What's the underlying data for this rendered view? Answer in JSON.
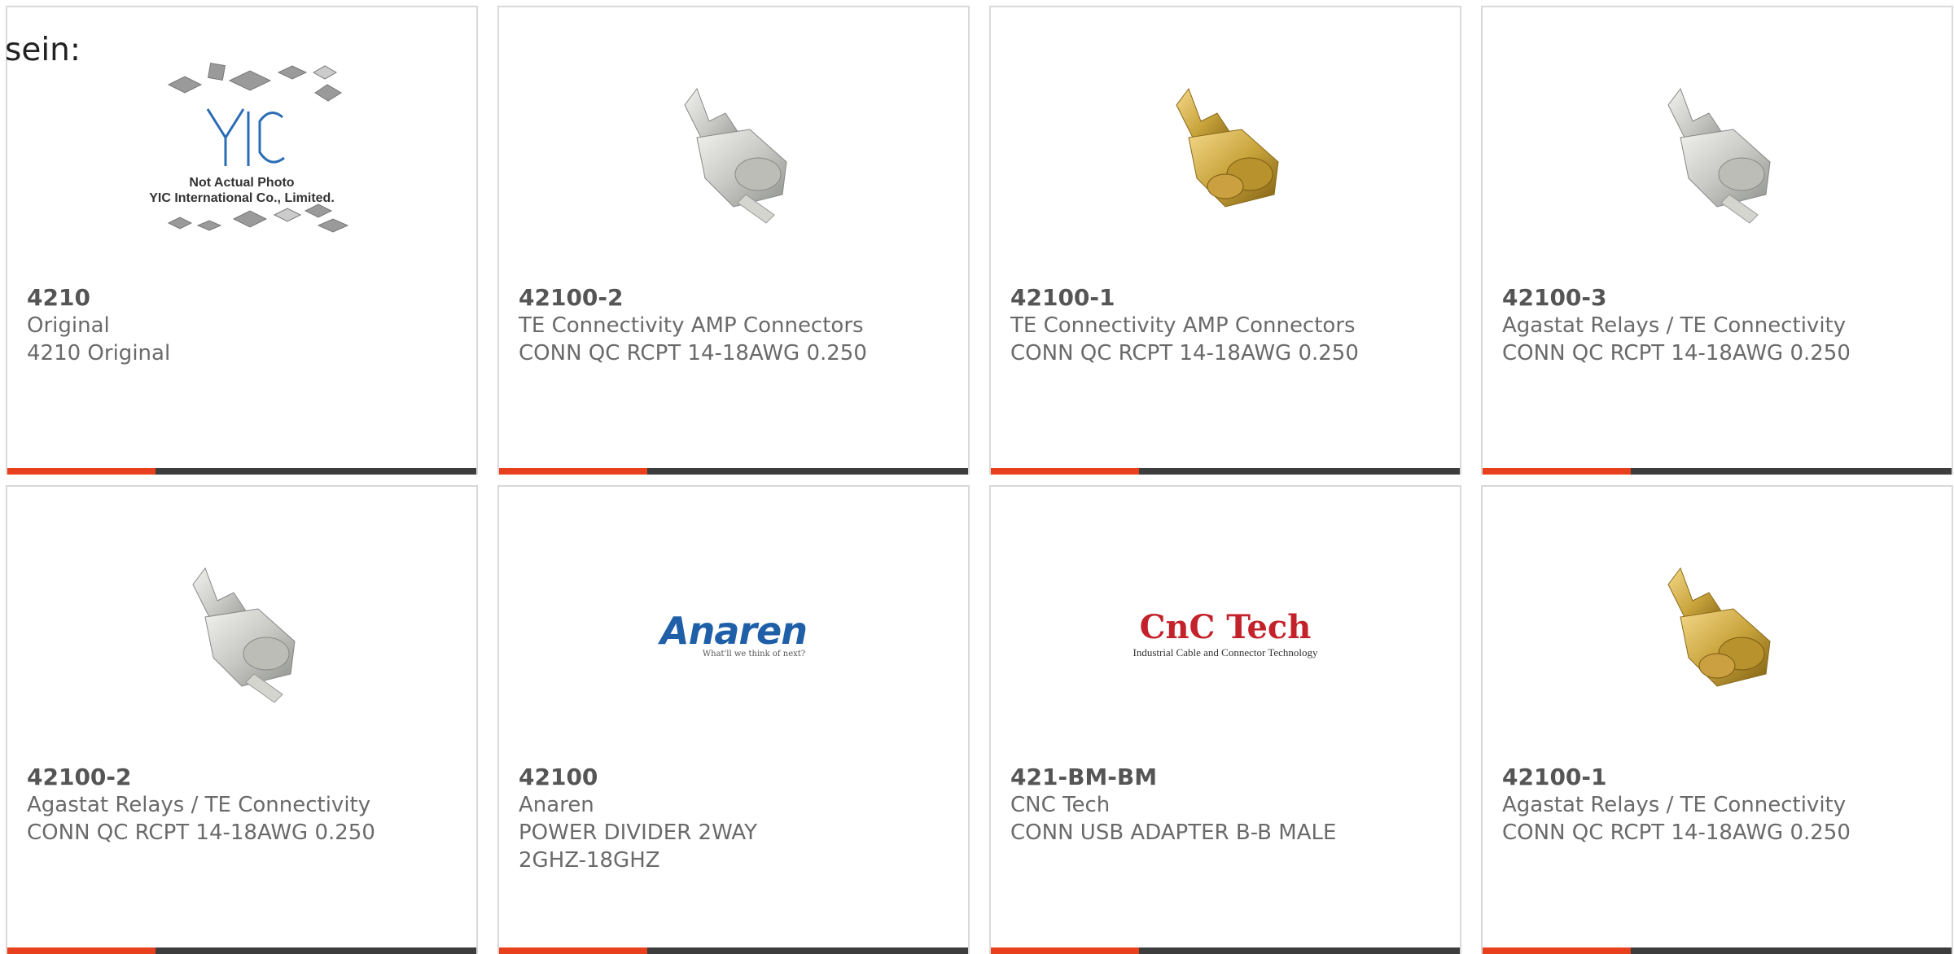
{
  "heading": "sein:",
  "colors": {
    "accent": "#e8401c",
    "bar": "#3d3d3d",
    "border": "#d9d9d9"
  },
  "placeholder_image": {
    "line1": "Not Actual Photo",
    "line2": "YIC International Co., Limited.",
    "logo": "YIC"
  },
  "logos": {
    "anaren": {
      "name": "Anaren",
      "tagline": "What'll we think of next?"
    },
    "cnc": {
      "name": "CnC Tech",
      "tagline": "Industrial Cable and Connector Technology"
    }
  },
  "products": [
    {
      "part_number": "4210",
      "manufacturer": "Original",
      "description": "4210 Original",
      "image": "placeholder-photo"
    },
    {
      "part_number": "42100-2",
      "manufacturer": "TE Connectivity AMP Connectors",
      "description": "CONN QC RCPT 14-18AWG 0.250",
      "image": "silver-terminal"
    },
    {
      "part_number": "42100-1",
      "manufacturer": "TE Connectivity AMP Connectors",
      "description": "CONN QC RCPT 14-18AWG 0.250",
      "image": "gold-terminal"
    },
    {
      "part_number": "42100-3",
      "manufacturer": "Agastat Relays / TE Connectivity",
      "description": "CONN QC RCPT 14-18AWG 0.250",
      "image": "silver-terminal"
    },
    {
      "part_number": "42100-2",
      "manufacturer": "Agastat Relays / TE Connectivity",
      "description": "CONN QC RCPT 14-18AWG 0.250",
      "image": "silver-terminal"
    },
    {
      "part_number": "42100",
      "manufacturer": "Anaren",
      "description": "POWER DIVIDER 2WAY 2GHZ-18GHZ",
      "image": "anaren-logo"
    },
    {
      "part_number": "421-BM-BM",
      "manufacturer": "CNC Tech",
      "description": "CONN USB ADAPTER B-B MALE",
      "image": "cnc-tech-logo"
    },
    {
      "part_number": "42100-1",
      "manufacturer": "Agastat Relays / TE Connectivity",
      "description": "CONN QC RCPT 14-18AWG 0.250",
      "image": "gold-terminal"
    }
  ]
}
